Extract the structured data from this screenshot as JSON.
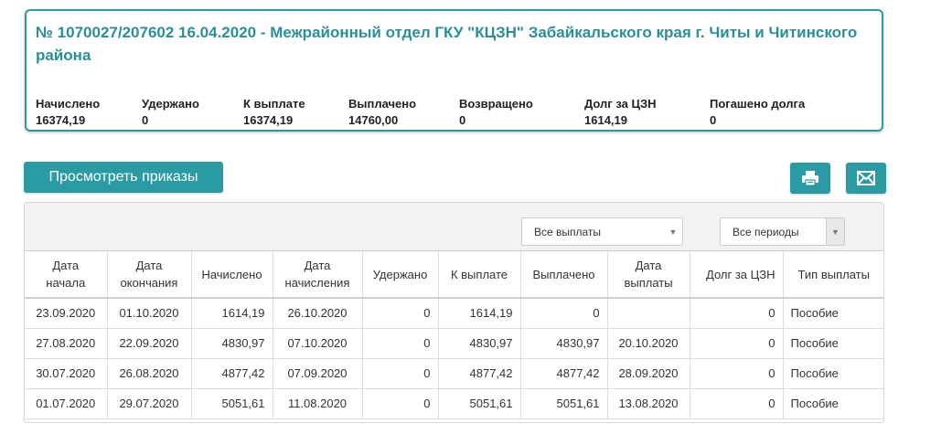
{
  "summary": {
    "title": "№ 1070027/207602 16.04.2020 - Межрайонный отдел ГКУ \"КЦЗН\" Забайкальского края г. Читы и Читинского района",
    "metrics": [
      {
        "label": "Начислено",
        "value": "16374,19"
      },
      {
        "label": "Удержано",
        "value": "0"
      },
      {
        "label": "К выплате",
        "value": "16374,19"
      },
      {
        "label": "Выплачено",
        "value": "14760,00"
      },
      {
        "label": "Возвращено",
        "value": "0"
      },
      {
        "label": "Долг за ЦЗН",
        "value": "1614,19"
      },
      {
        "label": "Погашено долга",
        "value": "0"
      }
    ]
  },
  "actions": {
    "orders_label": "Просмотреть приказы",
    "print_icon": "printer-icon",
    "mail_icon": "envelope-icon"
  },
  "filters": {
    "payments": "Все выплаты",
    "periods": "Все периоды"
  },
  "table": {
    "headers": [
      "Дата\nначала",
      "Дата\nокончания",
      "Начислено",
      "Дата\nначисления",
      "Удержано",
      "К выплате",
      "Выплачено",
      "Дата\nвыплаты",
      "Долг за ЦЗН",
      "Тип выплаты"
    ],
    "rows": [
      [
        "23.09.2020",
        "01.10.2020",
        "1614,19",
        "26.10.2020",
        "0",
        "1614,19",
        "0",
        "",
        "0",
        "Пособие"
      ],
      [
        "27.08.2020",
        "22.09.2020",
        "4830,97",
        "07.10.2020",
        "0",
        "4830,97",
        "4830,97",
        "20.10.2020",
        "0",
        "Пособие"
      ],
      [
        "30.07.2020",
        "26.08.2020",
        "4877,42",
        "07.09.2020",
        "0",
        "4877,42",
        "4877,42",
        "28.09.2020",
        "0",
        "Пособие"
      ],
      [
        "01.07.2020",
        "29.07.2020",
        "5051,61",
        "11.08.2020",
        "0",
        "5051,61",
        "5051,61",
        "13.08.2020",
        "0",
        "Пособие"
      ]
    ]
  },
  "colors": {
    "accent": "#2a9ba3",
    "title": "#2a8f98"
  }
}
